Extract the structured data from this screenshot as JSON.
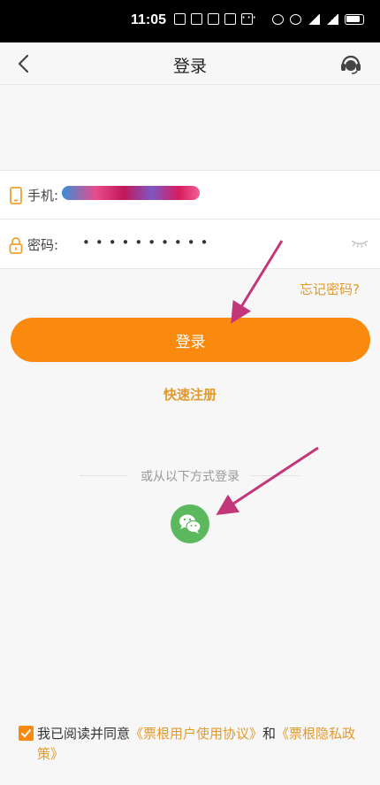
{
  "status_bar": {
    "time": "11:05",
    "more": "···"
  },
  "nav": {
    "title": "登录"
  },
  "form": {
    "phone_label": "手机:",
    "password_label": "密码:",
    "password_value": "••••••••••"
  },
  "forgot_password": "忘记密码?",
  "login_button": "登录",
  "quick_register": "快速注册",
  "other_login_label": "或从以下方式登录",
  "agreement": {
    "prefix": "我已阅读并同意",
    "user_agreement": "《票根用户使用协议》",
    "and": "和",
    "privacy_policy": "《票根隐私政策》"
  },
  "colors": {
    "accent": "#f98a0e",
    "link": "#e09a2e",
    "wechat": "#5cb85c",
    "annotation_arrow": "#c2377a"
  },
  "icons": [
    "back-arrow-icon",
    "headset-icon",
    "phone-icon",
    "lock-icon",
    "eye-closed-icon",
    "wechat-icon",
    "checkbox-checked-icon"
  ]
}
